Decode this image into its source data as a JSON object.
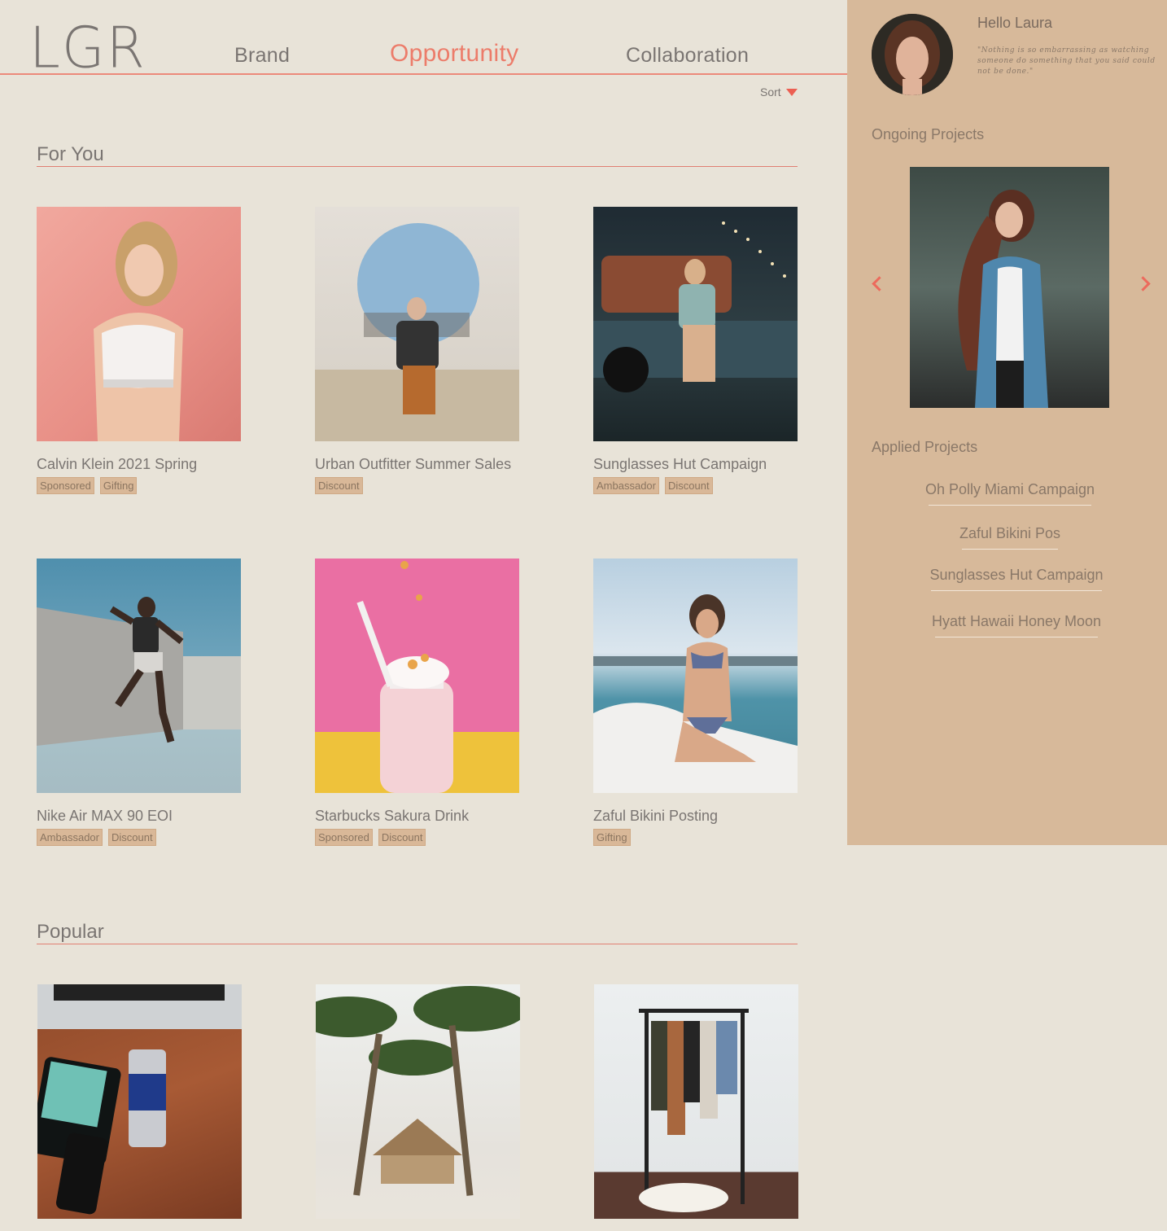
{
  "header": {
    "logo": "LGR",
    "nav": [
      {
        "label": "Brand"
      },
      {
        "label": "Opportunity"
      },
      {
        "label": "Collaboration"
      }
    ],
    "sort_label": "Sort"
  },
  "for_you": {
    "title": "For You",
    "cards": [
      {
        "title": "Calvin Klein 2021 Spring",
        "tags": [
          "Sponsored",
          "Gifting"
        ]
      },
      {
        "title": "Urban Outfitter Summer Sales",
        "tags": [
          "Discount"
        ]
      },
      {
        "title": "Sunglasses Hut Campaign",
        "tags": [
          "Ambassador",
          "Discount"
        ]
      },
      {
        "title": "Nike Air MAX 90 EOI",
        "tags": [
          "Ambassador",
          "Discount"
        ]
      },
      {
        "title": "Starbucks Sakura Drink",
        "tags": [
          "Sponsored",
          "Discount"
        ]
      },
      {
        "title": "Zaful Bikini Posting",
        "tags": [
          "Gifting"
        ]
      }
    ]
  },
  "popular": {
    "title": "Popular"
  },
  "sidebar": {
    "greeting": "Hello Laura",
    "quote": "\"Nothing is so embarrassing as watching someone do something that you said could not be done.\"",
    "ongoing_title": "Ongoing Projects",
    "applied_title": "Applied Projects",
    "applied": [
      {
        "label": "Oh Polly Miami Campaign"
      },
      {
        "label": "Zaful Bikini Pos"
      },
      {
        "label": "Sunglasses Hut Campaign"
      },
      {
        "label": "Hyatt Hawaii Honey Moon"
      }
    ]
  },
  "colors": {
    "background": "#e8e3d8",
    "sidebar": "#d7b99a",
    "accent": "#ec7c6a",
    "tag": "#d9b898"
  }
}
